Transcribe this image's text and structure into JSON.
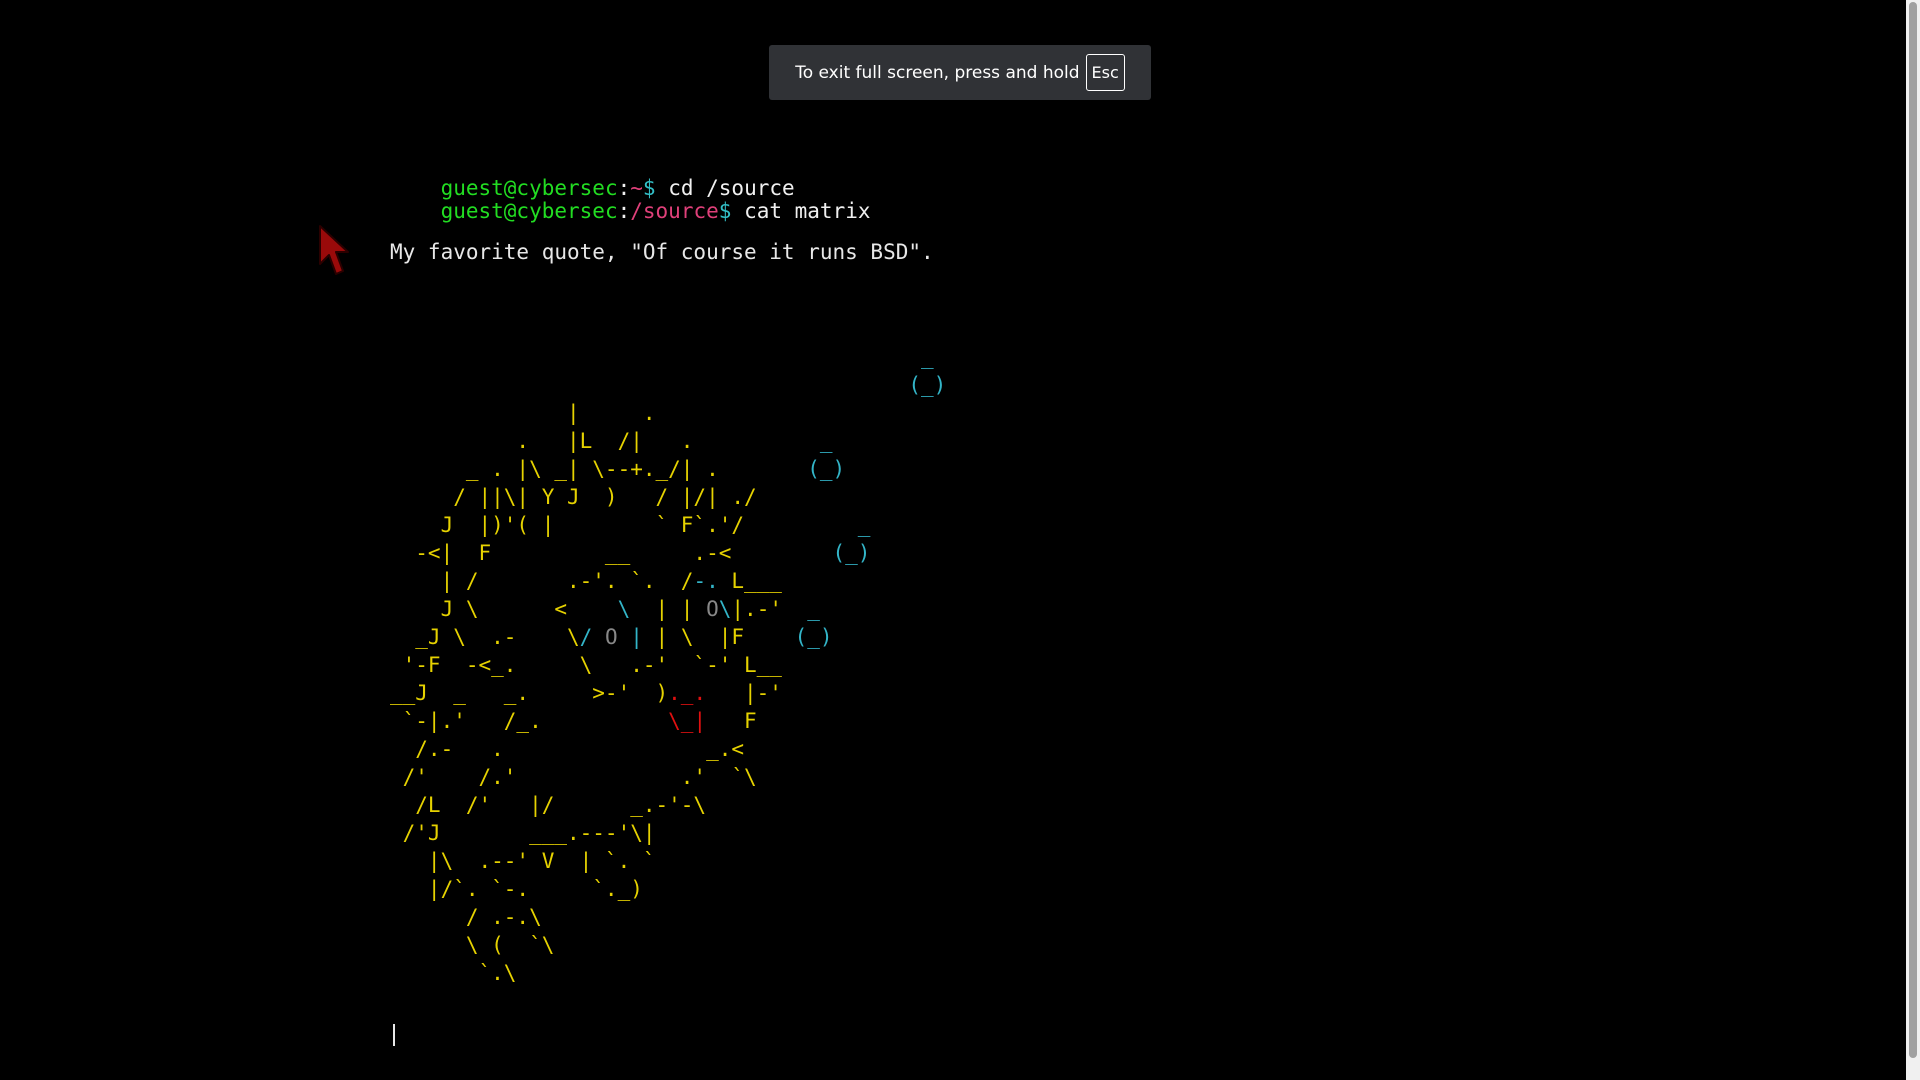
{
  "fullscreen_notice": {
    "text": "To exit full screen, press and hold",
    "key": "Esc"
  },
  "terminal": {
    "commands": [
      {
        "user": "guest@cybersec",
        "sep": ":",
        "path": "~",
        "prompt": "$",
        "cmd": " cd /source"
      },
      {
        "user": "guest@cybersec",
        "sep": ":",
        "path": "/source",
        "prompt": "$",
        "cmd": " cat matrix"
      }
    ],
    "quote": "My favorite quote, \"Of course it runs BSD\".",
    "ascii_art": [
      [
        [
          "                                          _",
          "cy"
        ]
      ],
      [
        [
          "                                         (_)",
          "cy"
        ]
      ],
      [
        [
          "              |     .",
          "y"
        ]
      ],
      [
        [
          "          .   |L  /|   .",
          "y"
        ],
        [
          "          _",
          "cy"
        ]
      ],
      [
        [
          "      _ . |\\ _| \\--+._/| .",
          "y"
        ],
        [
          "       (_)",
          "cy"
        ]
      ],
      [
        [
          "     / ||\\| Y J  )   / |/| ./",
          "y"
        ]
      ],
      [
        [
          "    J  |)'( |        ` F`.'/",
          "y"
        ],
        [
          "         _",
          "cy"
        ]
      ],
      [
        [
          "  -<|  F         __     .-<",
          "y"
        ],
        [
          "        (_)",
          "cy"
        ]
      ],
      [
        [
          "    | /       .-'. `.  /",
          "y"
        ],
        [
          "-.",
          "cy"
        ],
        [
          " L___",
          "y"
        ]
      ],
      [
        [
          "    J \\      <    ",
          "y"
        ],
        [
          "\\",
          "cy"
        ],
        [
          "  | | ",
          "y"
        ],
        [
          "O",
          "g"
        ],
        [
          "\\",
          "cy"
        ],
        [
          "|.-'",
          "y"
        ],
        [
          "  _",
          "cy"
        ]
      ],
      [
        [
          "  _J \\  .-    \\",
          "y"
        ],
        [
          "/ ",
          "cy"
        ],
        [
          "O",
          "g"
        ],
        [
          " |",
          "cy"
        ],
        [
          " | \\  |F",
          "y"
        ],
        [
          "    (_)",
          "cy"
        ]
      ],
      [
        [
          " '-F  -<_.     \\   .-'  `-' L__",
          "y"
        ]
      ],
      [
        [
          "__J  _   _.     >-'  )",
          "y"
        ],
        [
          "._.",
          "r"
        ],
        [
          "   |-'",
          "y"
        ]
      ],
      [
        [
          " `-|.'   /_.          ",
          "y"
        ],
        [
          "\\_|",
          "r"
        ],
        [
          "   F",
          "y"
        ]
      ],
      [
        [
          "  /.-   .                _.<",
          "y"
        ]
      ],
      [
        [
          " /'    /.'             .'  `\\",
          "y"
        ]
      ],
      [
        [
          "  /L  /'   |/      _.-'-\\",
          "y"
        ]
      ],
      [
        [
          " /'J       ___.---'\\|",
          "y"
        ]
      ],
      [
        [
          "   |\\  .--' V  | `. `",
          "y"
        ]
      ],
      [
        [
          "   |/`. `-.     `._)",
          "y"
        ]
      ],
      [
        [
          "      / .-.\\",
          "y"
        ]
      ],
      [
        [
          "      \\ (  `\\",
          "y"
        ]
      ],
      [
        [
          "       `.\\",
          "y"
        ]
      ]
    ]
  },
  "colors": {
    "background": "#000000",
    "user": "#22dd22",
    "path": "#e0407a",
    "dollar": "#33c0c8",
    "art": "#e6d200",
    "art_cyan": "#33b5c8",
    "art_red": "#e01010"
  }
}
